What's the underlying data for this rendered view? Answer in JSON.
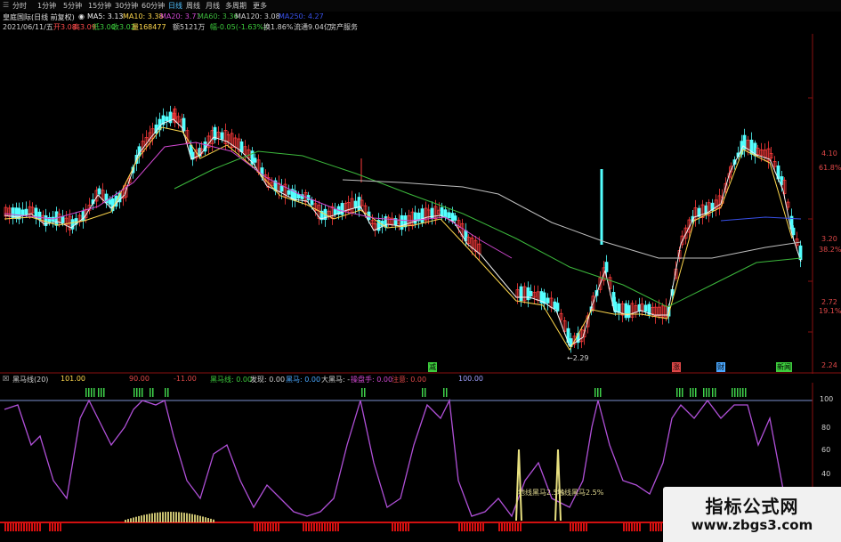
{
  "tabs": [
    {
      "label": "分时",
      "active": false
    },
    {
      "label": "1分钟",
      "active": false
    },
    {
      "label": "5分钟",
      "active": false
    },
    {
      "label": "15分钟",
      "active": false
    },
    {
      "label": "30分钟",
      "active": false
    },
    {
      "label": "60分钟",
      "active": false
    },
    {
      "label": "日线",
      "active": true
    },
    {
      "label": "周线",
      "active": false
    },
    {
      "label": "月线",
      "active": false
    },
    {
      "label": "多周期",
      "active": false
    },
    {
      "label": "更多",
      "active": false
    }
  ],
  "stock": {
    "name": "皇庭国际(日线 前复权)",
    "ma5": "MA5: 3.13",
    "ma10": "MA10: 3.38",
    "ma20": "MA20: 3.71",
    "ma60": "MA60: 3.36",
    "ma120": "MA120: 3.08",
    "ma250": "MA250: 4.27"
  },
  "quote": {
    "date": "2021/06/11/五",
    "open": "开3.08",
    "high": "高3.09",
    "low": "低3.00",
    "close": "收3.02",
    "volume": "量168477",
    "amount": "额5121万",
    "change": "幅-0.05(-1.63%)",
    "turnover": "换1.86%",
    "float_cap": "流通9.04亿",
    "sector": "房产服务"
  },
  "price_axis": {
    "labels": [
      {
        "text": "4.10",
        "color": "#e04848"
      },
      {
        "text": "61.8%",
        "color": "#e04848"
      },
      {
        "text": "3.20",
        "color": "#e04848"
      },
      {
        "text": "38.2%",
        "color": "#e04848"
      },
      {
        "text": "2.72",
        "color": "#e04848"
      },
      {
        "text": "19.1%",
        "color": "#e04848"
      },
      {
        "text": "2.24",
        "color": "#e04848"
      }
    ]
  },
  "annotations": {
    "low_marker": "←2.29",
    "bottom_markers": [
      {
        "text": "减",
        "color": "#3dcc3d"
      },
      {
        "text": "涨",
        "color": "#e04848"
      },
      {
        "text": "财",
        "color": "#4aa8ff"
      },
      {
        "text": "新闻",
        "color": "#3dcc3d"
      }
    ]
  },
  "indicator": {
    "name": "黑马线(20)",
    "value": "101.00",
    "v2": "90.00",
    "v3": "-11.00",
    "line_label": "黑马线: 0.00",
    "launch_label": "发现: 0.00",
    "hm_label": "黑马: 0.00",
    "big_hm_label": "大黑马: -",
    "op_label": "操盘手: 0.00",
    "warn_label": "注意: 0.00",
    "extra": "100.00",
    "axis_labels": [
      "100",
      "80",
      "60",
      "40",
      "20"
    ],
    "signal_labels": [
      "地线黑马2.5%",
      "地线黑马2.5%"
    ]
  },
  "watermark": {
    "title": "指标公式网",
    "url": "www.zbgs3.com"
  },
  "colors": {
    "up": "#ff3b3b",
    "down": "#53ffff",
    "ma5": "#f0f0f0",
    "ma10": "#ffd84d",
    "ma20": "#d048d0",
    "ma60": "#3cb83c",
    "ma120": "#bfbfbf",
    "ma250": "#3850e8",
    "indicator_line": "#b050d8",
    "indicator_bars": "#d81010",
    "signal": "#3fd14a",
    "vol_yellow": "#c8c070"
  }
}
